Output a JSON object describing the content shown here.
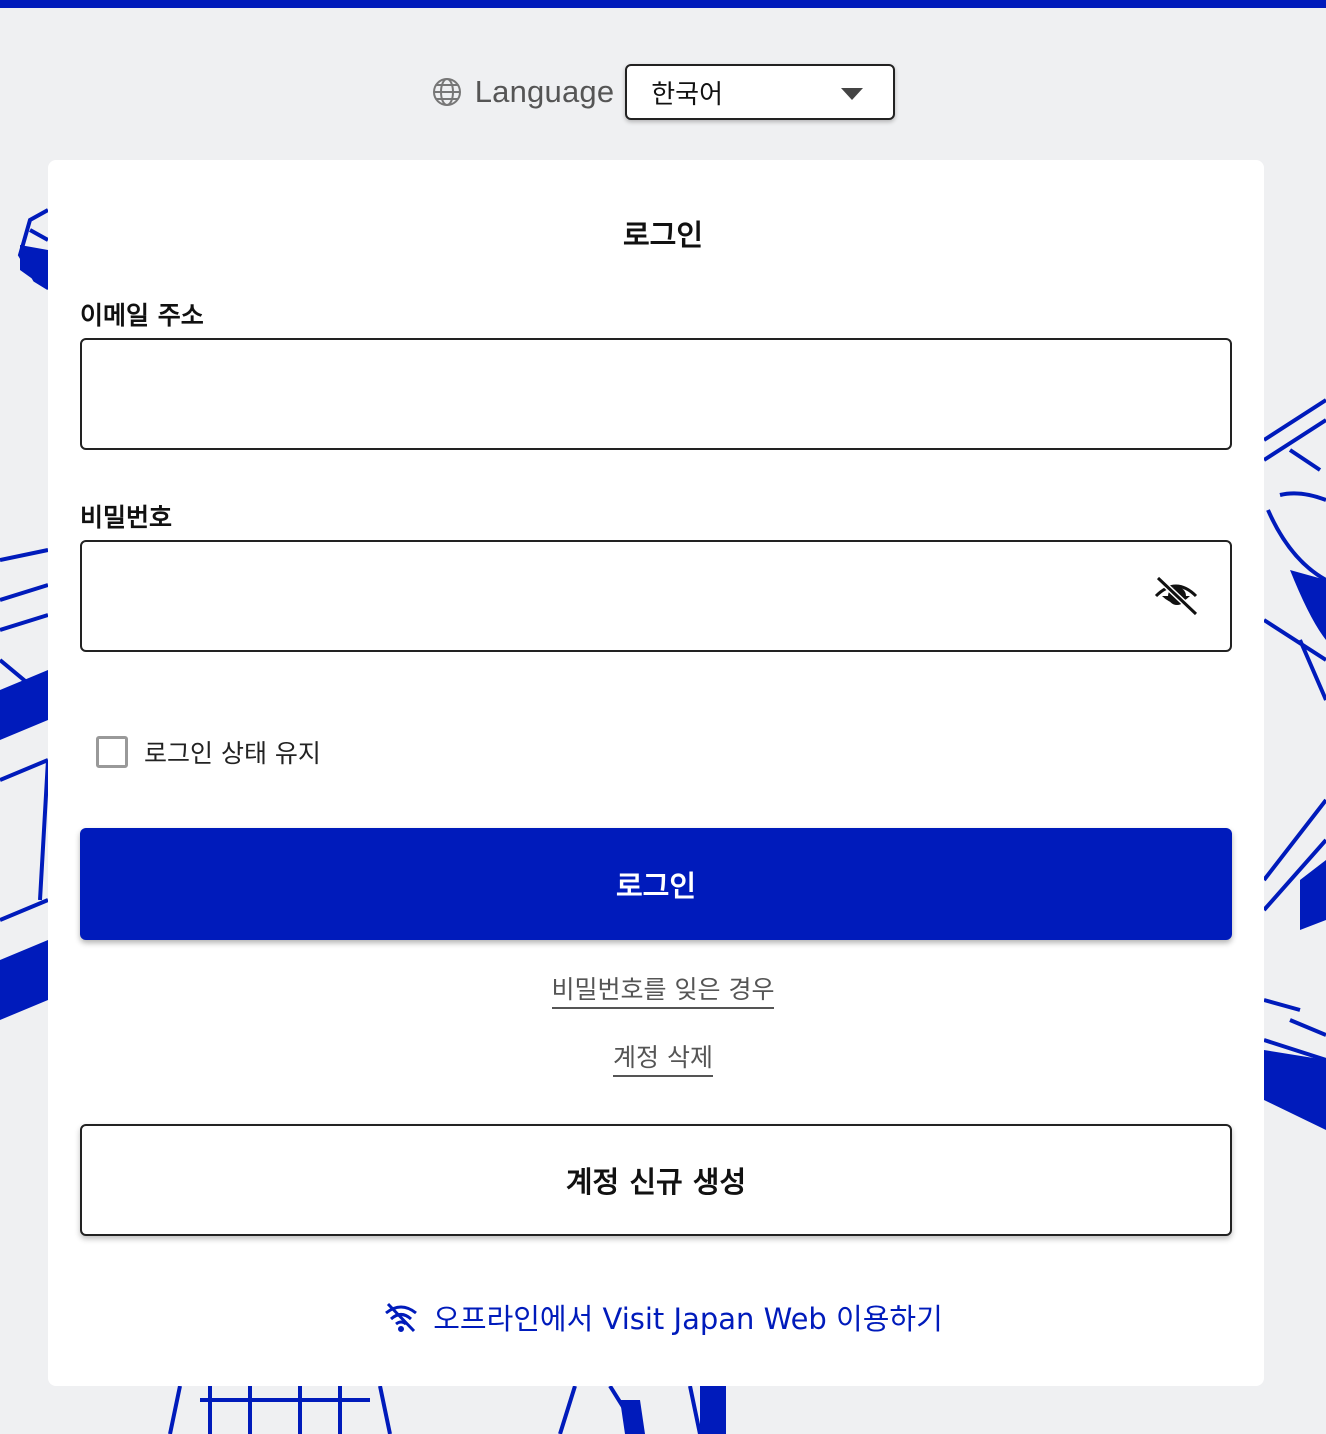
{
  "language": {
    "label": "Language",
    "selected": "한국어",
    "icon": "globe-icon"
  },
  "login": {
    "title": "로그인",
    "email_label": "이메일 주소",
    "email_value": "",
    "password_label": "비밀번호",
    "password_value": "",
    "password_toggle_icon": "eye-slash-icon",
    "remember_label": "로그인 상태 유지",
    "remember_checked": false,
    "submit_label": "로그인",
    "forgot_password": "비밀번호를 잊은 경우",
    "delete_account": "계정 삭제",
    "create_account": "계정 신규 생성",
    "offline_link": "오프라인에서 Visit Japan Web 이용하기",
    "offline_icon": "wifi-off-icon"
  },
  "colors": {
    "accent": "#001bbb",
    "background": "#eff0f2",
    "card": "#ffffff"
  }
}
